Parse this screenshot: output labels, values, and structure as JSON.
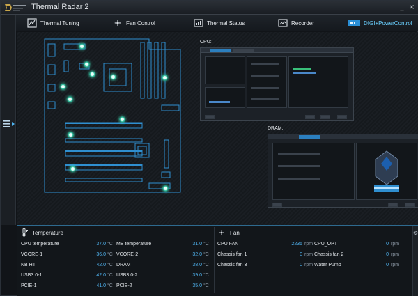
{
  "window": {
    "title": "Thermal Radar 2",
    "minimize_glyph": "_",
    "close_glyph": "×"
  },
  "tabs": [
    {
      "label": "Thermal Tuning",
      "icon": "thermal-tuning-icon"
    },
    {
      "label": "Fan Control",
      "icon": "fan-icon"
    },
    {
      "label": "Thermal Status",
      "icon": "thermal-status-icon"
    },
    {
      "label": "Recorder",
      "icon": "recorder-icon"
    },
    {
      "label": "DIGI+PowerControl",
      "icon": "digi-icon",
      "active": true
    }
  ],
  "panels": {
    "cpu_label": "CPU:",
    "dram_label": "DRAM:"
  },
  "temperature": {
    "title": "Temperature",
    "left": [
      {
        "label": "CPU temperature",
        "value": "37.0",
        "unit": "°C"
      },
      {
        "label": "VCORE-1",
        "value": "36.0",
        "unit": "°C"
      },
      {
        "label": "NB HT",
        "value": "42.0",
        "unit": "°C"
      },
      {
        "label": "USB3.0-1",
        "value": "42.0",
        "unit": "°C"
      },
      {
        "label": "PCIE-1",
        "value": "41.0",
        "unit": "°C"
      }
    ],
    "right": [
      {
        "label": "MB temperature",
        "value": "31.0",
        "unit": "°C"
      },
      {
        "label": "VCORE-2",
        "value": "32.0",
        "unit": "°C"
      },
      {
        "label": "DRAM",
        "value": "38.0",
        "unit": "°C"
      },
      {
        "label": "USB3.0-2",
        "value": "39.0",
        "unit": "°C"
      },
      {
        "label": "PCIE-2",
        "value": "35.0",
        "unit": "°C"
      }
    ]
  },
  "fan": {
    "title": "Fan",
    "left": [
      {
        "label": "CPU FAN",
        "value": "2235",
        "unit": "rpm"
      },
      {
        "label": "Chassis fan 1",
        "value": "0",
        "unit": "rpm"
      },
      {
        "label": "Chassis fan 3",
        "value": "0",
        "unit": "rpm"
      }
    ],
    "right": [
      {
        "label": "CPU_OPT",
        "value": "0",
        "unit": "rpm"
      },
      {
        "label": "Chassis fan 2",
        "value": "0",
        "unit": "rpm"
      },
      {
        "label": "Water Pump",
        "value": "0",
        "unit": "rpm"
      }
    ]
  },
  "colors": {
    "accent": "#4fb3f0",
    "sensor": "#37c7a4",
    "board_outline": "#2f8fd0"
  }
}
